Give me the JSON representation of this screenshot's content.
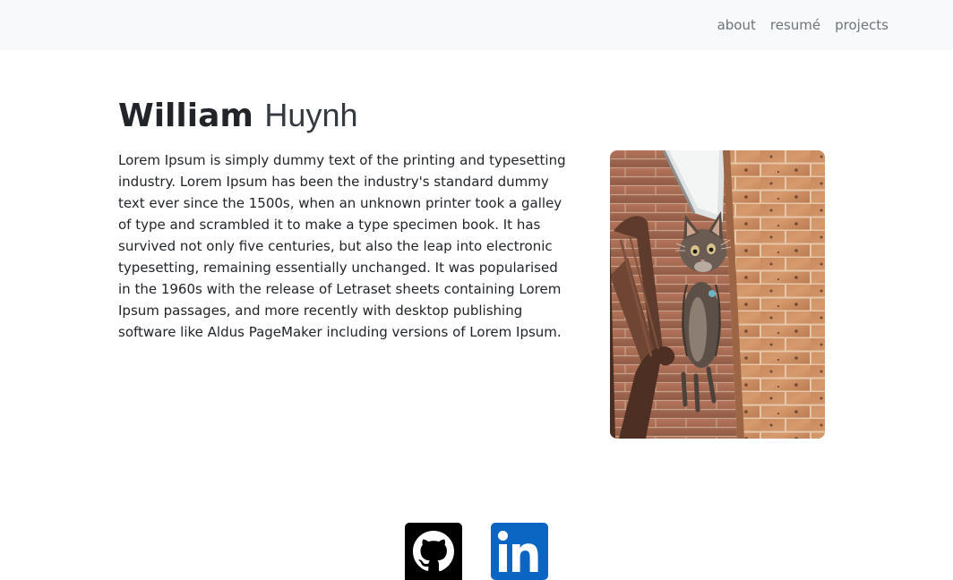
{
  "nav": {
    "links": [
      {
        "label": "about"
      },
      {
        "label": "resumé"
      },
      {
        "label": "projects"
      }
    ]
  },
  "hero": {
    "first_name": "William",
    "last_name": "Huynh",
    "bio": "Lorem Ipsum is simply dummy text of the printing and typesetting industry. Lorem Ipsum has been the industry's standard dummy text ever since the 1500s, when an unknown printer took a galley of type and scrambled it to make a type specimen book. It has survived not only five centuries, but also the leap into electronic typesetting, remaining essentially unchanged. It was popularised in the 1960s with the release of Letraset sheets containing Lorem Ipsum passages, and more recently with desktop publishing software like Aldus PageMaker including versions of Lorem Ipsum.",
    "photo_icon": "kitten-photo"
  },
  "social": {
    "items": [
      {
        "icon": "github-icon",
        "color": "#000000"
      },
      {
        "icon": "linkedin-icon",
        "color": "#0a66c2"
      }
    ]
  }
}
